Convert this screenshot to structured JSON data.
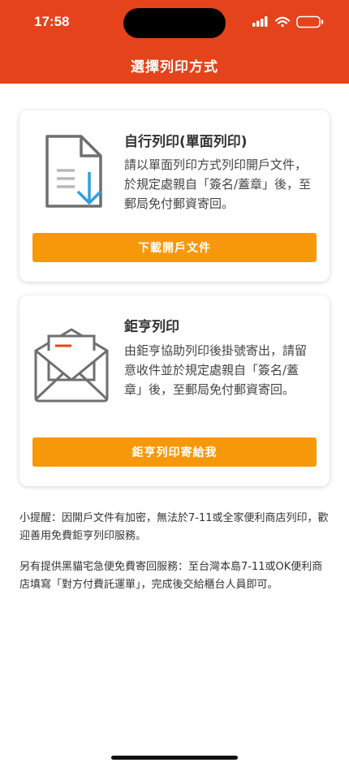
{
  "status_bar": {
    "time": "17:58"
  },
  "header": {
    "title": "選擇列印方式"
  },
  "options": [
    {
      "title": "自行列印(單面列印)",
      "description": "請以單面列印方式列印開戶文件，於規定處親自「簽名/蓋章」後，至郵局免付郵資寄回。",
      "button_label": "下載開戶文件",
      "icon": "document-download-icon"
    },
    {
      "title": "鉅亨列印",
      "description": "由鉅亨協助列印後掛號寄出，請留意收件並於規定處親自「簽名/蓋章」後，至郵局免付郵資寄回。",
      "button_label": "鉅亨列印寄給我",
      "icon": "envelope-letter-icon"
    }
  ],
  "notes": {
    "reminder": "小提醒：因開戶文件有加密，無法於7-11或全家便利商店列印，歡迎善用免費鉅亨列印服務。",
    "return_service": "另有提供黑貓宅急便免費寄回服務：至台灣本島7-11或OK便利商店填寫「對方付費託運單」，完成後交給櫃台人員即可。"
  },
  "colors": {
    "header": "#e4431c",
    "button": "#f7980b",
    "icon_gray": "#6f6f6f",
    "icon_blue": "#2f9fe0"
  }
}
